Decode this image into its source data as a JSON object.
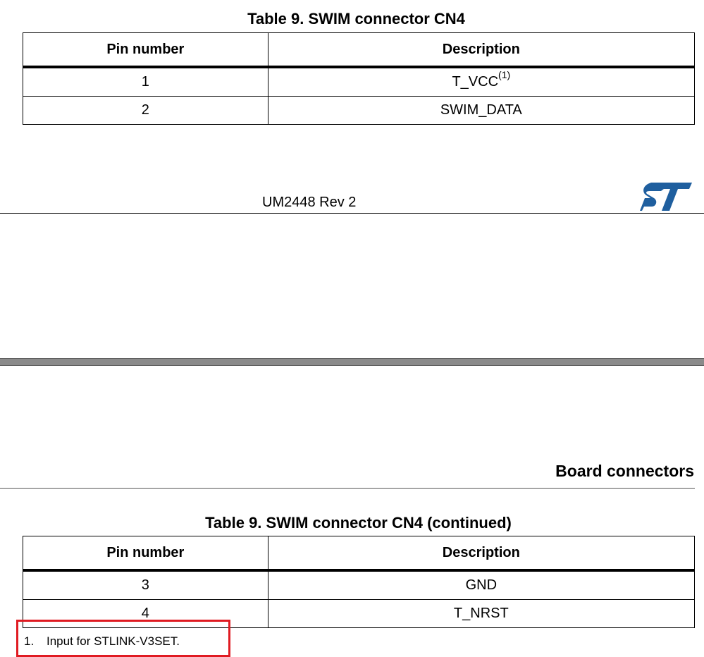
{
  "table1": {
    "title": "Table 9. SWIM connector CN4",
    "headers": [
      "Pin number",
      "Description"
    ],
    "rows": [
      {
        "pin": "1",
        "desc": "T_VCC",
        "sup": "(1)"
      },
      {
        "pin": "2",
        "desc": "SWIM_DATA"
      }
    ]
  },
  "footer": {
    "doc_rev": "UM2448 Rev 2",
    "logo": "st-logo",
    "logo_color": "#1f5f9f"
  },
  "section": {
    "title": "Board connectors"
  },
  "table2": {
    "title": "Table 9. SWIM connector CN4 (continued)",
    "headers": [
      "Pin number",
      "Description"
    ],
    "rows": [
      {
        "pin": "3",
        "desc": "GND"
      },
      {
        "pin": "4",
        "desc": "T_NRST"
      }
    ]
  },
  "footnote": {
    "number": "1.",
    "text": "Input for STLINK-V3SET.",
    "highlight_color": "#e01b22"
  }
}
